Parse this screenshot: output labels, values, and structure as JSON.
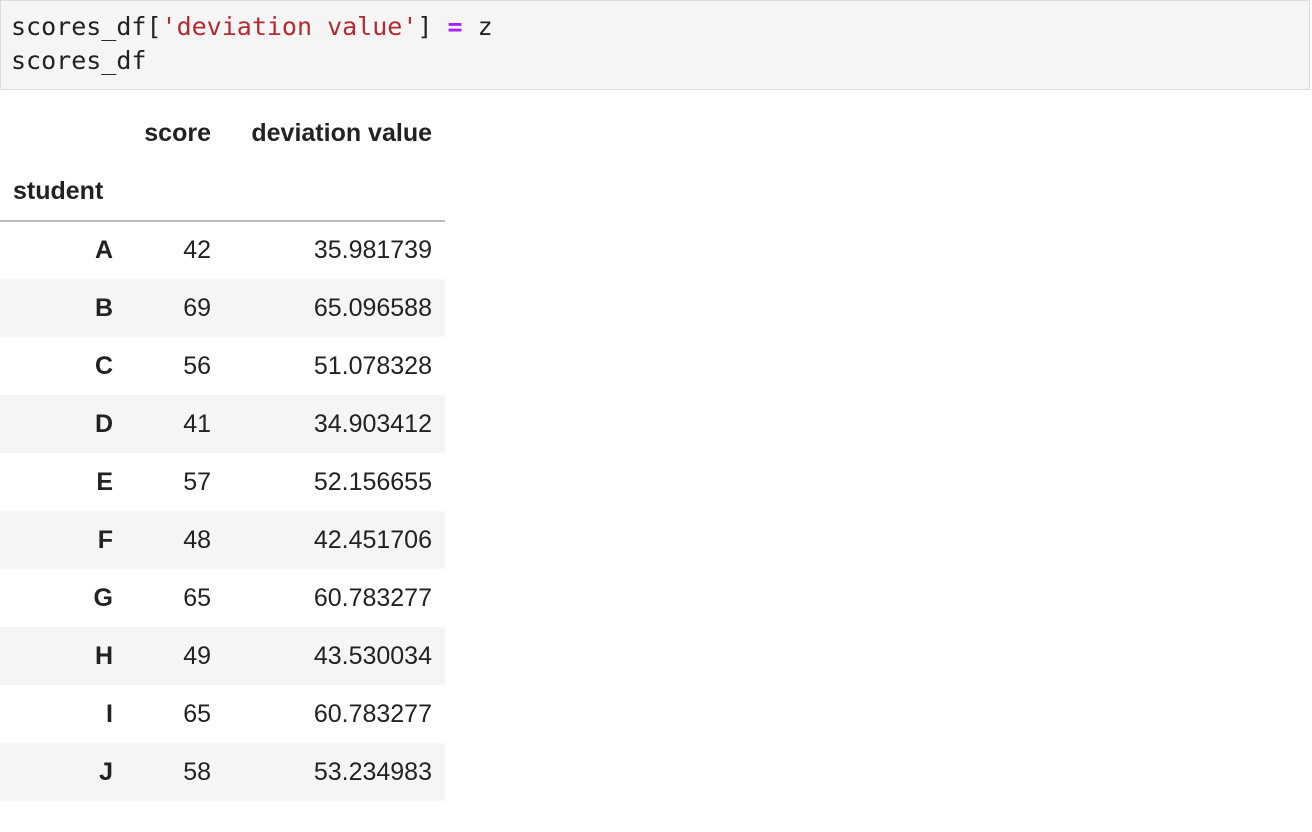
{
  "code_cell": {
    "line1": {
      "var": "scores_df[",
      "string": "'deviation value'",
      "close": "] ",
      "operator": "=",
      "rhs": " z"
    },
    "line2": "scores_df"
  },
  "dataframe": {
    "columns": [
      "score",
      "deviation value"
    ],
    "index_name": "student",
    "rows": [
      {
        "index": "A",
        "score": "42",
        "deviation_value": "35.981739"
      },
      {
        "index": "B",
        "score": "69",
        "deviation_value": "65.096588"
      },
      {
        "index": "C",
        "score": "56",
        "deviation_value": "51.078328"
      },
      {
        "index": "D",
        "score": "41",
        "deviation_value": "34.903412"
      },
      {
        "index": "E",
        "score": "57",
        "deviation_value": "52.156655"
      },
      {
        "index": "F",
        "score": "48",
        "deviation_value": "42.451706"
      },
      {
        "index": "G",
        "score": "65",
        "deviation_value": "60.783277"
      },
      {
        "index": "H",
        "score": "49",
        "deviation_value": "43.530034"
      },
      {
        "index": "I",
        "score": "65",
        "deviation_value": "60.783277"
      },
      {
        "index": "J",
        "score": "58",
        "deviation_value": "53.234983"
      }
    ]
  },
  "colors": {
    "code_background": "#f5f5f5",
    "string": "#b22b31",
    "operator": "#aa22ff",
    "stripe": "#f5f5f5"
  }
}
